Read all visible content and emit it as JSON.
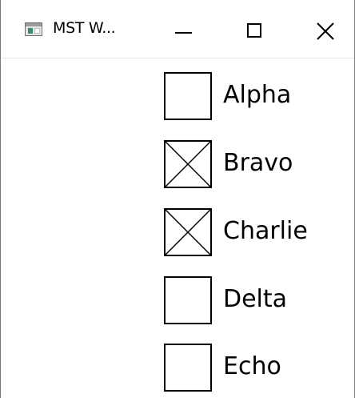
{
  "window": {
    "title": "MST W...",
    "icon": "app-window-icon",
    "controls": {
      "minimize": "minimize-icon",
      "maximize": "maximize-icon",
      "close": "close-icon"
    }
  },
  "options": [
    {
      "label": "Alpha",
      "checked": false
    },
    {
      "label": "Bravo",
      "checked": true
    },
    {
      "label": "Charlie",
      "checked": true
    },
    {
      "label": "Delta",
      "checked": false
    },
    {
      "label": "Echo",
      "checked": false
    }
  ],
  "colors": {
    "checkbox_border": "#000000",
    "text": "#000000",
    "background": "#ffffff"
  }
}
